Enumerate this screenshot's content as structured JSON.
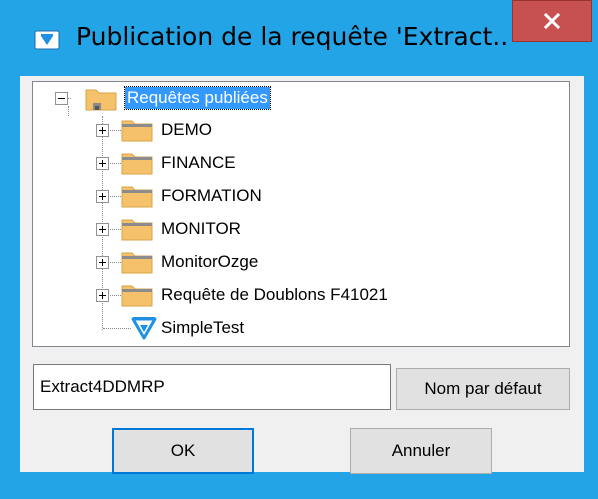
{
  "window": {
    "title": "Publication de la requête 'Extract...",
    "close_glyph": "x"
  },
  "tree": {
    "root": {
      "label": "Requêtes publiées",
      "expanded": true,
      "selected": true
    },
    "children": [
      {
        "label": "DEMO",
        "icon": "folder-icon",
        "expandable": true
      },
      {
        "label": "FINANCE",
        "icon": "folder-icon",
        "expandable": true
      },
      {
        "label": "FORMATION",
        "icon": "folder-icon",
        "expandable": true
      },
      {
        "label": "MONITOR",
        "icon": "folder-icon",
        "expandable": true
      },
      {
        "label": "MonitorOzge",
        "icon": "folder-icon",
        "expandable": true
      },
      {
        "label": "Requête de Doublons F41021",
        "icon": "folder-icon",
        "expandable": true
      },
      {
        "label": "SimpleTest",
        "icon": "query-icon",
        "expandable": false
      }
    ]
  },
  "name_field": {
    "value": "Extract4DDMRP"
  },
  "buttons": {
    "default_name": "Nom par défaut",
    "ok": "OK",
    "cancel": "Annuler"
  },
  "colors": {
    "frame": "#23a4e6",
    "close": "#c75050",
    "selection": "#3399ff",
    "folder": "#f5c26b",
    "query_icon": "#1e90e6"
  }
}
